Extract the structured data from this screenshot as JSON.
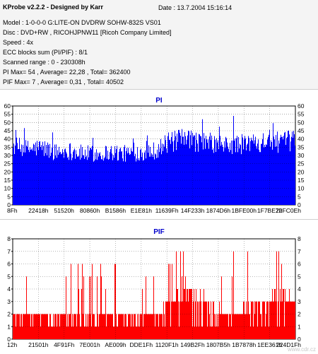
{
  "header": {
    "app_title": "KProbe v2.2.2 - Designed by Karr",
    "date": "Date : 13.7.2004 15:16:14",
    "lines": [
      "Model : 1-0-0-0 G:LITE-ON DVDRW SOHW-832S  VS01",
      "Disc : DVD+RW , RICOHJPNW11 [Ricoh Company Limited]",
      "Speed : 4x",
      "ECC blocks sum (PI/PIF) : 8/1",
      "Scanned range : 0 - 230308h",
      "PI Max= 54 , Average= 22,28 , Total= 362400",
      "PIF Max= 7 , Average= 0,31 , Total= 40502"
    ]
  },
  "watermark": "www.cdr.cz",
  "chart_data": [
    {
      "type": "bar",
      "title": "PI",
      "color": "#0000ff",
      "ylim": [
        0,
        60
      ],
      "yticks": [
        0,
        5,
        10,
        15,
        20,
        25,
        30,
        35,
        40,
        45,
        50,
        55,
        60
      ],
      "x_tick_labels": [
        "8Fh",
        "22418h",
        "51520h",
        "80860h",
        "B1586h",
        "E1E81h",
        "11639Fh",
        "14F233h",
        "1874D6h",
        "1BFE00h",
        "1F7BE7h",
        "22FC0Eh"
      ],
      "x_range": [
        "0h",
        "230308h"
      ],
      "profile": [
        [
          0,
          38
        ],
        [
          0.05,
          36
        ],
        [
          0.1,
          37
        ],
        [
          0.15,
          34
        ],
        [
          0.2,
          35
        ],
        [
          0.25,
          33
        ],
        [
          0.3,
          33
        ],
        [
          0.35,
          34
        ],
        [
          0.4,
          33
        ],
        [
          0.45,
          34
        ],
        [
          0.5,
          35
        ],
        [
          0.55,
          40
        ],
        [
          0.6,
          42
        ],
        [
          0.65,
          41
        ],
        [
          0.7,
          40
        ],
        [
          0.75,
          38
        ],
        [
          0.8,
          39
        ],
        [
          0.85,
          40
        ],
        [
          0.9,
          42
        ],
        [
          0.95,
          40
        ],
        [
          1,
          42
        ]
      ],
      "max": 54,
      "average": 22.28,
      "grid": true
    },
    {
      "type": "bar",
      "title": "PIF",
      "color": "#ff0000",
      "ylim": [
        0,
        8
      ],
      "yticks": [
        0,
        1,
        2,
        3,
        4,
        5,
        6,
        7,
        8
      ],
      "x_tick_labels": [
        "12h",
        "21501h",
        "4F91Fh",
        "7E001h",
        "AE009h",
        "DDE1Fh",
        "1120F1h",
        "149B2Fh",
        "1807B5h",
        "1B7878h",
        "1EE361h",
        "224D1Fh"
      ],
      "x_range": [
        "0h",
        "230308h"
      ],
      "profile": [
        [
          0,
          2
        ],
        [
          0.1,
          2
        ],
        [
          0.2,
          2
        ],
        [
          0.3,
          2
        ],
        [
          0.4,
          2
        ],
        [
          0.5,
          2
        ],
        [
          0.55,
          3
        ],
        [
          0.6,
          4
        ],
        [
          0.65,
          4
        ],
        [
          0.7,
          3
        ],
        [
          0.75,
          2
        ],
        [
          0.8,
          2
        ],
        [
          0.85,
          3
        ],
        [
          0.9,
          3
        ],
        [
          0.95,
          4
        ],
        [
          1,
          3
        ]
      ],
      "max": 7,
      "average": 0.31,
      "grid": true
    }
  ]
}
